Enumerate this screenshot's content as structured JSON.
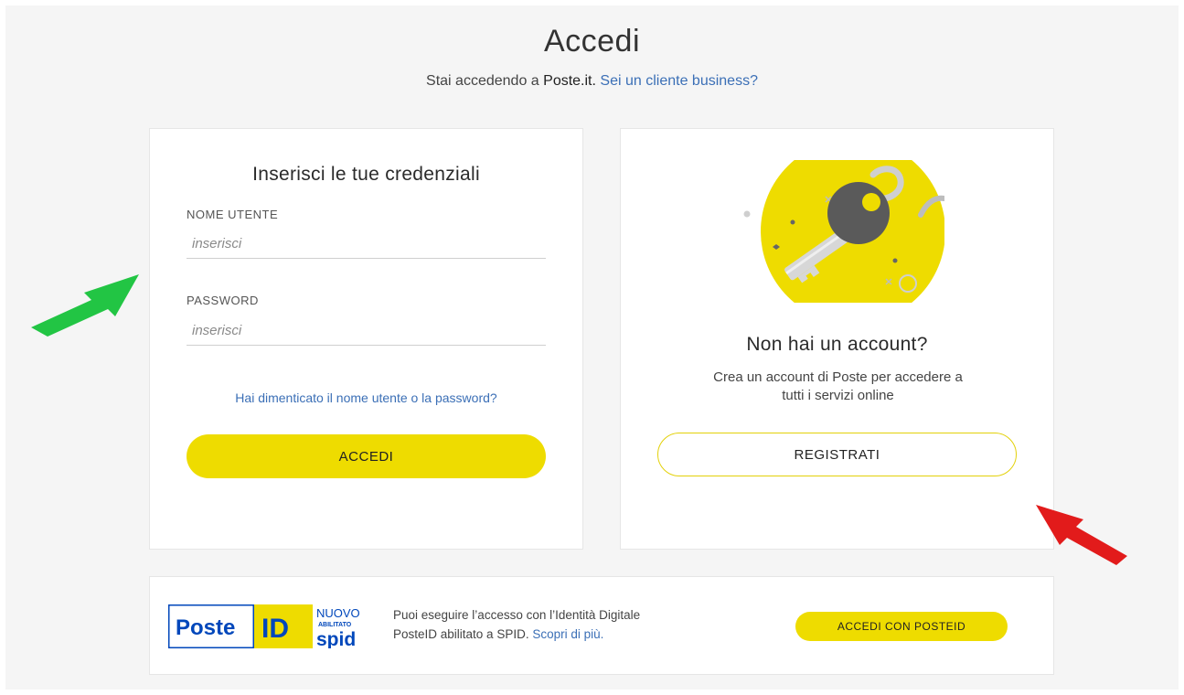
{
  "header": {
    "title": "Accedi",
    "subtitle_prefix": "Stai accedendo a",
    "subtitle_brand": "Poste.it.",
    "business_link": "Sei un cliente business?"
  },
  "login": {
    "title": "Inserisci le tue credenziali",
    "username_label": "NOME UTENTE",
    "username_placeholder": "inserisci",
    "password_label": "PASSWORD",
    "password_placeholder": "inserisci",
    "forgot_link": "Hai dimenticato il nome utente o la password?",
    "submit_label": "ACCEDI"
  },
  "register": {
    "illustration_icon": "key-icon",
    "title": "Non hai un account?",
    "description_line1": "Crea un account di Poste per accedere a",
    "description_line2": "tutti i servizi online",
    "button_label": "REGISTRATI"
  },
  "spid": {
    "logo_poste": "Poste",
    "logo_id": "ID",
    "logo_nuovo": "NUOVO",
    "logo_abilitato": "ABILITATO",
    "logo_spid": "spid",
    "text_line1": "Puoi eseguire l’accesso con l’Identità Digitale",
    "text_line2_prefix": "PosteID abilitato a SPID.",
    "text_link": "Scopri di più.",
    "button_label": "ACCEDI CON POSTEID"
  },
  "annotations": {
    "green_arrow_icon": "green-arrow-icon",
    "red_arrow_icon": "red-arrow-icon"
  },
  "colors": {
    "accent_yellow": "#eedc00",
    "link_blue": "#3b6fb6",
    "background": "#f5f5f5",
    "poste_blue": "#0047bb"
  }
}
